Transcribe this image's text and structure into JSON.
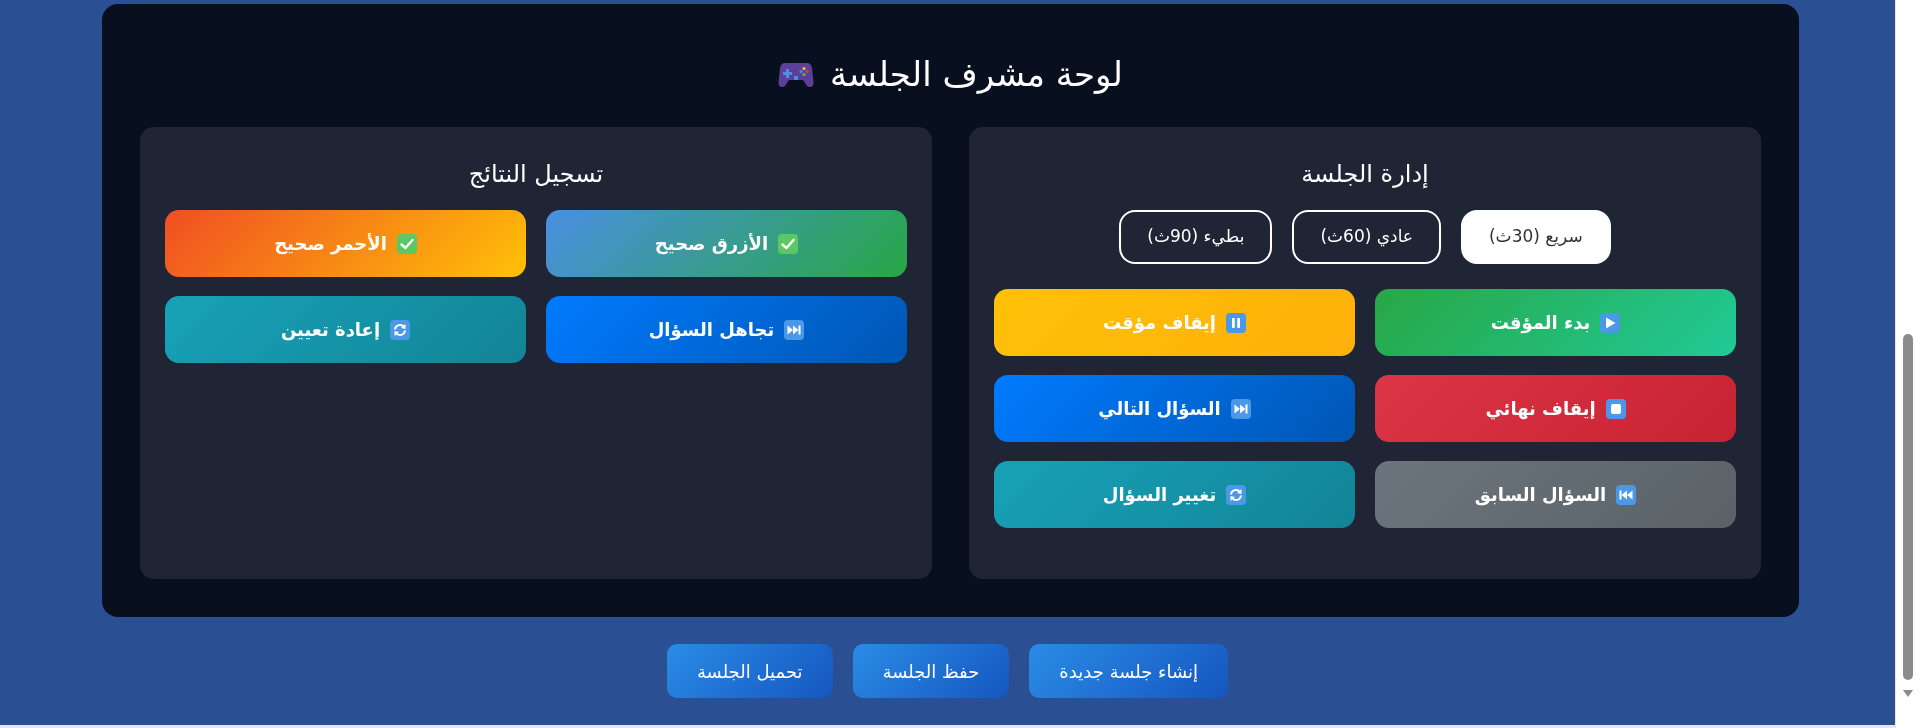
{
  "title": "لوحة مشرف الجلسة",
  "session_panel": {
    "title": "إدارة الجلسة",
    "speeds": [
      {
        "label": "سريع (30ث)",
        "selected": true
      },
      {
        "label": "عادي (60ث)",
        "selected": false
      },
      {
        "label": "بطيء (90ث)",
        "selected": false
      }
    ],
    "actions": [
      {
        "kind": "start",
        "label": "بدء المؤقت"
      },
      {
        "kind": "pause",
        "label": "إيقاف مؤقت"
      },
      {
        "kind": "stop",
        "label": "إيقاف نهائي"
      },
      {
        "kind": "next",
        "label": "السؤال التالي"
      },
      {
        "kind": "previous",
        "label": "السؤال السابق"
      },
      {
        "kind": "change",
        "label": "تغيير السؤال"
      }
    ]
  },
  "results_panel": {
    "title": "تسجيل النتائج",
    "actions": [
      {
        "kind": "blue",
        "label": "الأزرق صحيح"
      },
      {
        "kind": "red",
        "label": "الأحمر صحيح"
      },
      {
        "kind": "skip",
        "label": "تجاهل السؤال"
      },
      {
        "kind": "reset",
        "label": "إعادة تعيين"
      }
    ]
  },
  "footer_buttons": [
    "إنشاء جلسة جديدة",
    "حفظ الجلسة",
    "تحميل الجلسة"
  ]
}
